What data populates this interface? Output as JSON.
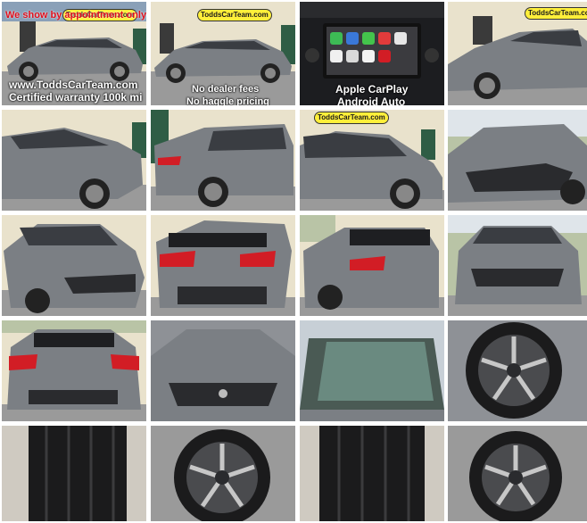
{
  "photo_captions": {
    "appointment": "We show by appointment only",
    "website": "www.ToddsCarTeam.com",
    "warranty": "Certified warranty 100k mi",
    "no_dealer_fees": "No dealer fees",
    "no_haggle": "No haggle pricing",
    "carplay": "Apple CarPlay",
    "android_auto": "Android Auto"
  },
  "signs": {
    "dealer_sign": "ToddsCarTeam.com"
  },
  "colors": {
    "car_gray": "#7b7f84",
    "building_cream": "#e9e2cc",
    "door_green": "#2f5d45",
    "tail_red": "#d21d25",
    "sign_yellow": "#ffef3a"
  }
}
